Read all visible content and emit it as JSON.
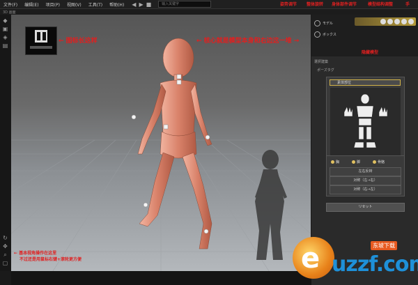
{
  "menu": {
    "items": [
      "文件(F)",
      "编辑(E)",
      "项目(P)",
      "视图(V)",
      "工具(T)",
      "帮助(H)"
    ],
    "search_placeholder": "输入关键字"
  },
  "tab": {
    "viewport_label": "3D 画面"
  },
  "annotations": {
    "icon_note": "← 图标长这样",
    "core_note": "← 核心就是模型本身和右边这一堆 →",
    "view_note_line1": "← 基本视角操作在这里",
    "view_note_line2": "不过还是用鼠标右键+滚轮更方便",
    "top_labels": [
      "姿势调节",
      "整体旋转",
      "身体部件调节",
      "模型结构调整",
      "手"
    ],
    "hide_model": "隐藏模型"
  },
  "right_panel": {
    "top_rows": [
      "モデル",
      "ボックス"
    ],
    "section_title": "選択建築",
    "subsection": "ポーズタグ",
    "card_head": "素体部位",
    "options": [
      "胸",
      "脚",
      "骨骼"
    ],
    "buttons": [
      "左右反转",
      "对称（左→右）",
      "对称（右→左）"
    ],
    "reset": "リセット"
  },
  "watermark": {
    "text": "uzzf.com",
    "tag": "东坡下载"
  },
  "colors": {
    "annotation": "#e02020",
    "accent": "#d4b44a",
    "figure": "#d9826a"
  }
}
